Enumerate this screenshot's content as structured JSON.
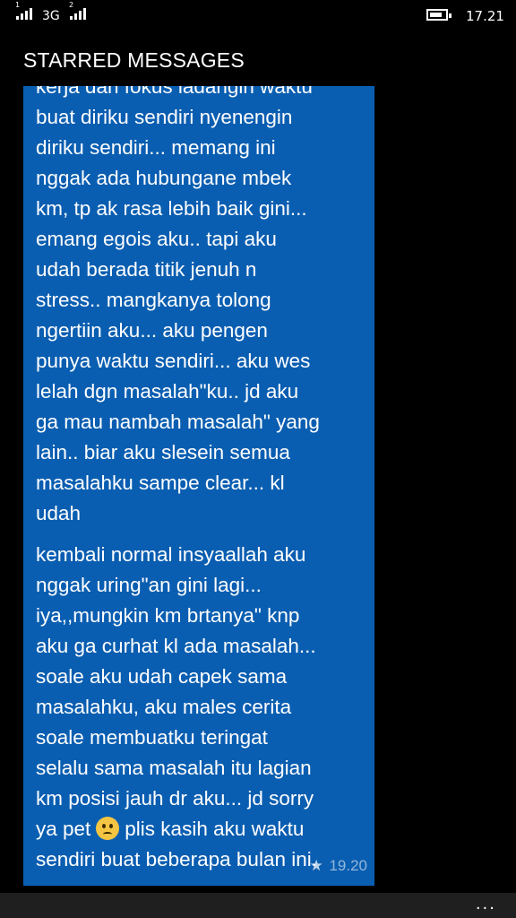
{
  "status_bar": {
    "sim1_label": "1",
    "sim2_label": "2",
    "network_type": "3G",
    "time": "17.21",
    "battery_level": 0.8
  },
  "header": {
    "title": "STARRED MESSAGES"
  },
  "messages": [
    {
      "text_top_partial": "kerja dan fokus ladangin waktu",
      "text": "buat diriku sendiri nyenengin\ndiriku sendiri... memang ini\nnggak ada hubungane mbek\nkm, tp ak rasa lebih baik gini...\nemang egois aku.. tapi aku\nudah berada titik jenuh n\nstress.. mangkanya tolong\nngertiin aku... aku pengen\npunya waktu sendiri... aku wes\nlelah dgn masalah\"ku.. jd aku\nga mau nambah masalah\" yang\nlain.. biar aku slesein semua\nmasalahku sampe clear... kl\nudah",
      "starred": true
    },
    {
      "text_before_emoji": "kembali normal insyaallah aku\nnggak uring\"an gini lagi...\niya,,mungkin km brtanya\" knp\naku ga curhat kl ada masalah...\nsoale aku udah capek sama\nmasalahku, aku males cerita\nsoale membuatku teringat\nselalu sama masalah itu lagian\nkm posisi jauh dr aku... jd sorry\nya pet",
      "emoji": "confused-face",
      "text_after_emoji": "plis kasih aku waktu\nsendiri buat beberapa bulan ini.",
      "time": "19.20",
      "starred": true
    }
  ],
  "app_bar": {
    "more_label": "..."
  }
}
